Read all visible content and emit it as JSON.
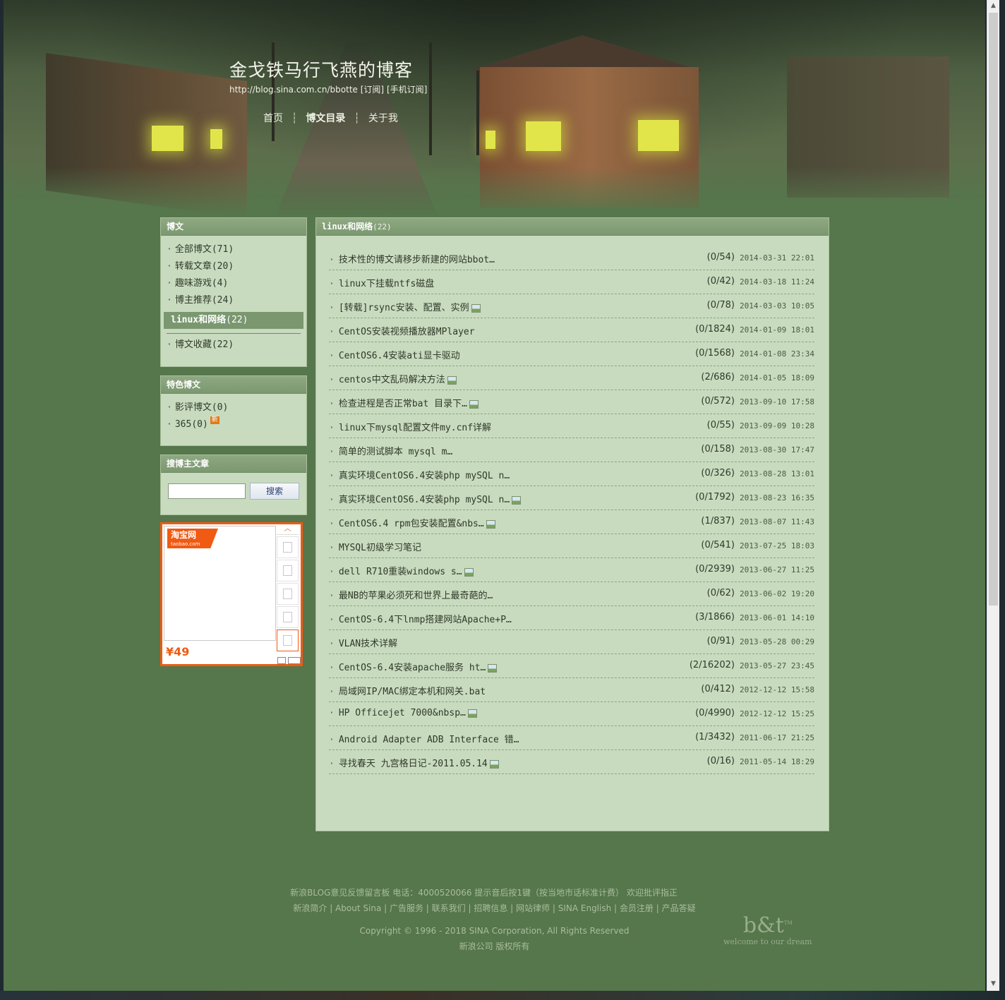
{
  "header": {
    "blog_title": "金戈铁马行飞燕的博客",
    "blog_url": "http://blog.sina.com.cn/bbotte",
    "subscribe": "[订阅]",
    "mobile_subscribe": "[手机订阅]",
    "nav": [
      "首页",
      "博文目录",
      "关于我"
    ]
  },
  "sidebar": {
    "posts_box": {
      "title": "博文",
      "items": [
        {
          "label": "全部博文",
          "count": "(71)"
        },
        {
          "label": "转载文章",
          "count": "(20)"
        },
        {
          "label": "趣味游戏",
          "count": "(4)"
        },
        {
          "label": "博主推荐",
          "count": "(24)"
        },
        {
          "label": "linux和网络",
          "count": "(22)"
        },
        {
          "label": "博文收藏",
          "count": "(22)"
        }
      ]
    },
    "featured_box": {
      "title": "特色博文",
      "items": [
        {
          "label": "影评博文",
          "count": "(0)"
        },
        {
          "label": "365",
          "count": "(0)",
          "badge": "新"
        }
      ]
    },
    "search_box": {
      "title": "搜博主文章",
      "input_value": "",
      "button": "搜索"
    },
    "ad": {
      "logo": "淘宝网",
      "logo_sub": "taobao.com",
      "price": "¥49"
    }
  },
  "main": {
    "category": "linux和网络",
    "count": "(22)",
    "articles": [
      {
        "title": "技术性的博文请移步新建的网站bbot…",
        "img": false,
        "stats": "(0/54)",
        "date": "2014-03-31 22:01"
      },
      {
        "title": "linux下挂载ntfs磁盘",
        "img": false,
        "stats": "(0/42)",
        "date": "2014-03-18 11:24"
      },
      {
        "title": "[转载]rsync安装、配置、实例",
        "img": true,
        "stats": "(0/78)",
        "date": "2014-03-03 10:05"
      },
      {
        "title": "CentOS安装视频播放器MPlayer",
        "img": false,
        "stats": "(0/1824)",
        "date": "2014-01-09 18:01"
      },
      {
        "title": "CentOS6.4安装ati显卡驱动",
        "img": false,
        "stats": "(0/1568)",
        "date": "2014-01-08 23:34"
      },
      {
        "title": "centos中文乱码解决方法",
        "img": true,
        "stats": "(2/686)",
        "date": "2014-01-05 18:09"
      },
      {
        "title": "检查进程是否正常bat  目录下…",
        "img": true,
        "stats": "(0/572)",
        "date": "2013-09-10 17:58"
      },
      {
        "title": "linux下mysql配置文件my.cnf详解",
        "img": false,
        "stats": "(0/55)",
        "date": "2013-09-09 10:28"
      },
      {
        "title": "简单的测试脚本  mysql  m…",
        "img": false,
        "stats": "(0/158)",
        "date": "2013-08-30 17:47"
      },
      {
        "title": "真实环境CentOS6.4安装php  mySQL  n…",
        "img": false,
        "stats": "(0/326)",
        "date": "2013-08-28 13:01"
      },
      {
        "title": "真实环境CentOS6.4安装php  mySQL  n…",
        "img": true,
        "stats": "(0/1792)",
        "date": "2013-08-23 16:35"
      },
      {
        "title": "CentOS6.4  rpm包安装配置&nbs…",
        "img": true,
        "stats": "(1/837)",
        "date": "2013-08-07 11:43"
      },
      {
        "title": "MYSQL初级学习笔记",
        "img": false,
        "stats": "(0/541)",
        "date": "2013-07-25 18:03"
      },
      {
        "title": "dell  R710重装windows  s…",
        "img": true,
        "stats": "(0/2939)",
        "date": "2013-06-27 11:25"
      },
      {
        "title": "最NB的苹果必须死和世界上最奇葩的…",
        "img": false,
        "stats": "(0/62)",
        "date": "2013-06-02 19:20"
      },
      {
        "title": "CentOS-6.4下lnmp搭建网站Apache+P…",
        "img": false,
        "stats": "(3/1866)",
        "date": "2013-06-01 14:10"
      },
      {
        "title": "VLAN技术详解",
        "img": false,
        "stats": "(0/91)",
        "date": "2013-05-28 00:29"
      },
      {
        "title": "CentOS-6.4安装apache服务  ht…",
        "img": true,
        "stats": "(2/16202)",
        "date": "2013-05-27 23:45"
      },
      {
        "title": "局域网IP/MAC绑定本机和网关.bat",
        "img": false,
        "stats": "(0/412)",
        "date": "2012-12-12 15:58"
      },
      {
        "title": "HP  Officejet  7000&nbsp…",
        "img": true,
        "stats": "(0/4990)",
        "date": "2012-12-12 15:25"
      },
      {
        "title": "Android  Adapter  ADB  Interface  错…",
        "img": false,
        "stats": "(1/3432)",
        "date": "2011-06-17 21:25"
      },
      {
        "title": "寻找春天  九宫格日记-2011.05.14",
        "img": true,
        "stats": "(0/16)",
        "date": "2011-05-14 18:29"
      }
    ]
  },
  "footer": {
    "line1": "新浪BLOG意见反馈留言板  电话：4000520066 提示音后按1键（按当地市话标准计费）  欢迎批评指正",
    "links": [
      "新浪简介",
      "About Sina",
      "广告服务",
      "联系我们",
      "招聘信息",
      "网站律师",
      "SINA English",
      "会员注册",
      "产品答疑"
    ],
    "copyright": "Copyright © 1996 - 2018 SINA Corporation, All Rights Reserved",
    "rights": "新浪公司 版权所有",
    "logo_text": "b&t",
    "logo_tm": "TM",
    "logo_tagline": "welcome to our dream"
  }
}
